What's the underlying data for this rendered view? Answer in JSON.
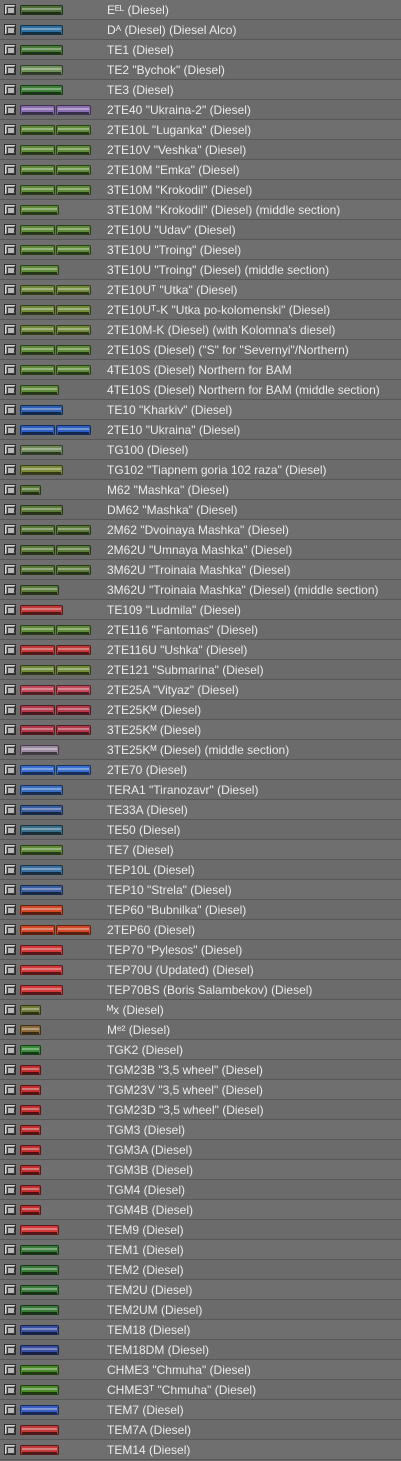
{
  "locomotives": [
    {
      "label": "Eᴱᴸ (Diesel)",
      "color": "#4f6f3a",
      "icon": "loco-sprite-green"
    },
    {
      "label": "Dᴬ (Diesel) (Diesel Alco)",
      "color": "#2f6fa0",
      "icon": "loco-sprite-blue"
    },
    {
      "label": "TE1 (Diesel)",
      "color": "#4a7a3a",
      "icon": "loco-sprite-green"
    },
    {
      "label": "TE2 \"Bychok\" (Diesel)",
      "color": "#6f8f5a",
      "icon": "loco-sprite-green"
    },
    {
      "label": "TE3 (Diesel)",
      "color": "#3f7f3a",
      "icon": "loco-sprite-green"
    },
    {
      "label": "2TE40 \"Ukraina-2\" (Diesel)",
      "color": "#8a6fb0",
      "icon": "loco-sprite-purple"
    },
    {
      "label": "2TE10L \"Luganka\" (Diesel)",
      "color": "#5f8a3a",
      "icon": "loco-sprite-green"
    },
    {
      "label": "2TE10V \"Veshka\" (Diesel)",
      "color": "#5f8a3a",
      "icon": "loco-sprite-green"
    },
    {
      "label": "2TE10M \"Emka\" (Diesel)",
      "color": "#5f8a3a",
      "icon": "loco-sprite-green"
    },
    {
      "label": "3TE10M \"Krokodil\" (Diesel)",
      "color": "#5f8a3a",
      "icon": "loco-sprite-green"
    },
    {
      "label": "3TE10M \"Krokodil\" (Diesel) (middle section)",
      "color": "#5f8a3a",
      "icon": "loco-sprite-green"
    },
    {
      "label": "2TE10U \"Udav\" (Diesel)",
      "color": "#5f8a3a",
      "icon": "loco-sprite-green"
    },
    {
      "label": "3TE10U \"Troing\" (Diesel)",
      "color": "#5f8a3a",
      "icon": "loco-sprite-green"
    },
    {
      "label": "3TE10U \"Troing\" (Diesel) (middle section)",
      "color": "#5f8a3a",
      "icon": "loco-sprite-green"
    },
    {
      "label": "2TE10Uᵀ \"Utka\" (Diesel)",
      "color": "#6f8a3a",
      "icon": "loco-sprite-green"
    },
    {
      "label": "2TE10Uᵀ-K \"Utka po-kolomenski\" (Diesel)",
      "color": "#6f8a3a",
      "icon": "loco-sprite-green"
    },
    {
      "label": "2TE10M-K (Diesel) (with Kolomna's diesel)",
      "color": "#6f8a3a",
      "icon": "loco-sprite-green"
    },
    {
      "label": "2TE10S (Diesel) (\"S\" for \"Severnyi\"/Northern)",
      "color": "#5f8a3a",
      "icon": "loco-sprite-green"
    },
    {
      "label": "4TE10S (Diesel) Northern for BAM",
      "color": "#5f8a3a",
      "icon": "loco-sprite-green"
    },
    {
      "label": "4TE10S (Diesel) Northern for BAM (middle section)",
      "color": "#5f8a3a",
      "icon": "loco-sprite-green"
    },
    {
      "label": "TE10 \"Kharkiv\" (Diesel)",
      "color": "#2f5fb0",
      "icon": "loco-sprite-blue"
    },
    {
      "label": "2TE10 \"Ukraina\" (Diesel)",
      "color": "#2f5fc0",
      "icon": "loco-sprite-blue"
    },
    {
      "label": "TG100 (Diesel)",
      "color": "#6f8a5a",
      "icon": "loco-sprite-green"
    },
    {
      "label": "TG102 \"Tiapnem goria 102 raza\" (Diesel)",
      "color": "#7a8a3a",
      "icon": "loco-sprite-green"
    },
    {
      "label": "M62 \"Mashka\" (Diesel)",
      "color": "#5a7a3a",
      "icon": "loco-sprite-green"
    },
    {
      "label": "DM62 \"Mashka\" (Diesel)",
      "color": "#5a7a3a",
      "icon": "loco-sprite-green"
    },
    {
      "label": "2M62 \"Dvoinaya Mashka\" (Diesel)",
      "color": "#5a7a3a",
      "icon": "loco-sprite-green"
    },
    {
      "label": "2M62U \"Umnaya Mashka\" (Diesel)",
      "color": "#5a7a3a",
      "icon": "loco-sprite-green"
    },
    {
      "label": "3M62U \"Troinaia Mashka\" (Diesel)",
      "color": "#5a7a3a",
      "icon": "loco-sprite-green"
    },
    {
      "label": "3M62U \"Troinaia Mashka\" (Diesel) (middle section)",
      "color": "#5a7a3a",
      "icon": "loco-sprite-green"
    },
    {
      "label": "TE109 \"Ludmila\" (Diesel)",
      "color": "#c03a3a",
      "icon": "loco-sprite-red"
    },
    {
      "label": "2TE116 \"Fantomas\" (Diesel)",
      "color": "#5f8a3a",
      "icon": "loco-sprite-green"
    },
    {
      "label": "2TE116U \"Ushka\" (Diesel)",
      "color": "#c03a3a",
      "icon": "loco-sprite-red"
    },
    {
      "label": "2TE121 \"Submarina\" (Diesel)",
      "color": "#6f8a3a",
      "icon": "loco-sprite-green"
    },
    {
      "label": "2TE25A \"Vityaz\" (Diesel)",
      "color": "#c04a5a",
      "icon": "loco-sprite-red"
    },
    {
      "label": "2TE25Kᴹ (Diesel)",
      "color": "#b03a4a",
      "icon": "loco-sprite-red"
    },
    {
      "label": "3TE25Kᴹ (Diesel)",
      "color": "#b03a4a",
      "icon": "loco-sprite-red"
    },
    {
      "label": "3TE25Kᴹ (Diesel) (middle section)",
      "color": "#9a8aa0",
      "icon": "loco-sprite-grey"
    },
    {
      "label": "2TE70 (Diesel)",
      "color": "#3a6fd0",
      "icon": "loco-sprite-blue"
    },
    {
      "label": "TERA1 \"Tiranozavr\" (Diesel)",
      "color": "#3a6fc0",
      "icon": "loco-sprite-blue"
    },
    {
      "label": "TE33A (Diesel)",
      "color": "#3a5fa0",
      "icon": "loco-sprite-blue"
    },
    {
      "label": "TE50 (Diesel)",
      "color": "#3a6f8a",
      "icon": "loco-sprite-blue"
    },
    {
      "label": "TE7 (Diesel)",
      "color": "#5f8a3a",
      "icon": "loco-sprite-green"
    },
    {
      "label": "TEP10L (Diesel)",
      "color": "#3a6fa0",
      "icon": "loco-sprite-blue"
    },
    {
      "label": "TEP10 \"Strela\" (Diesel)",
      "color": "#3a5fa0",
      "icon": "loco-sprite-blue"
    },
    {
      "label": "TEP60 \"Bubnilka\" (Diesel)",
      "color": "#d04a2a",
      "icon": "loco-sprite-red"
    },
    {
      "label": "2TEP60 (Diesel)",
      "color": "#d04a2a",
      "icon": "loco-sprite-red"
    },
    {
      "label": "TEP70 \"Pylesos\" (Diesel)",
      "color": "#d03a3a",
      "icon": "loco-sprite-red"
    },
    {
      "label": "TEP70U (Updated) (Diesel)",
      "color": "#d03a3a",
      "icon": "loco-sprite-red"
    },
    {
      "label": "TEP70BS (Boris Salambekov) (Diesel)",
      "color": "#d03a3a",
      "icon": "loco-sprite-red"
    },
    {
      "label": "ᴹx (Diesel)",
      "color": "#6f7a3a",
      "icon": "loco-sprite-green"
    },
    {
      "label": "Mᵉ² (Diesel)",
      "color": "#8a6a3a",
      "icon": "loco-sprite-brown"
    },
    {
      "label": "TGK2 (Diesel)",
      "color": "#3a8a3a",
      "icon": "loco-sprite-green"
    },
    {
      "label": "TGM23B \"3,5 wheel\" (Diesel)",
      "color": "#c03030",
      "icon": "loco-sprite-red"
    },
    {
      "label": "TGM23V \"3,5 wheel\" (Diesel)",
      "color": "#c03030",
      "icon": "loco-sprite-red"
    },
    {
      "label": "TGM23D \"3,5 wheel\" (Diesel)",
      "color": "#c03030",
      "icon": "loco-sprite-red"
    },
    {
      "label": "TGM3 (Diesel)",
      "color": "#c03030",
      "icon": "loco-sprite-red"
    },
    {
      "label": "TGM3A (Diesel)",
      "color": "#c03030",
      "icon": "loco-sprite-red"
    },
    {
      "label": "TGM3B (Diesel)",
      "color": "#c03030",
      "icon": "loco-sprite-red"
    },
    {
      "label": "TGM4 (Diesel)",
      "color": "#c03030",
      "icon": "loco-sprite-red"
    },
    {
      "label": "TGM4B (Diesel)",
      "color": "#c03030",
      "icon": "loco-sprite-red"
    },
    {
      "label": "TEM9 (Diesel)",
      "color": "#d03a3a",
      "icon": "loco-sprite-red"
    },
    {
      "label": "TEM1 (Diesel)",
      "color": "#3a7a3a",
      "icon": "loco-sprite-green"
    },
    {
      "label": "TEM2 (Diesel)",
      "color": "#3a7a3a",
      "icon": "loco-sprite-green"
    },
    {
      "label": "TEM2U (Diesel)",
      "color": "#3a7a3a",
      "icon": "loco-sprite-green"
    },
    {
      "label": "TEM2UM (Diesel)",
      "color": "#3a7a3a",
      "icon": "loco-sprite-green"
    },
    {
      "label": "TEM18 (Diesel)",
      "color": "#3a4fa0",
      "icon": "loco-sprite-blue"
    },
    {
      "label": "TEM18DM (Diesel)",
      "color": "#3a4fa0",
      "icon": "loco-sprite-blue"
    },
    {
      "label": "CHME3 \"Chmuha\" (Diesel)",
      "color": "#4a8a2a",
      "icon": "loco-sprite-green"
    },
    {
      "label": "CHME3ᵀ \"Chmuha\" (Diesel)",
      "color": "#4a8a2a",
      "icon": "loco-sprite-green"
    },
    {
      "label": "TEM7 (Diesel)",
      "color": "#3a5fc0",
      "icon": "loco-sprite-blue"
    },
    {
      "label": "TEM7A (Diesel)",
      "color": "#c03a3a",
      "icon": "loco-sprite-red"
    },
    {
      "label": "TEM14 (Diesel)",
      "color": "#c03a3a",
      "icon": "loco-sprite-red"
    }
  ]
}
